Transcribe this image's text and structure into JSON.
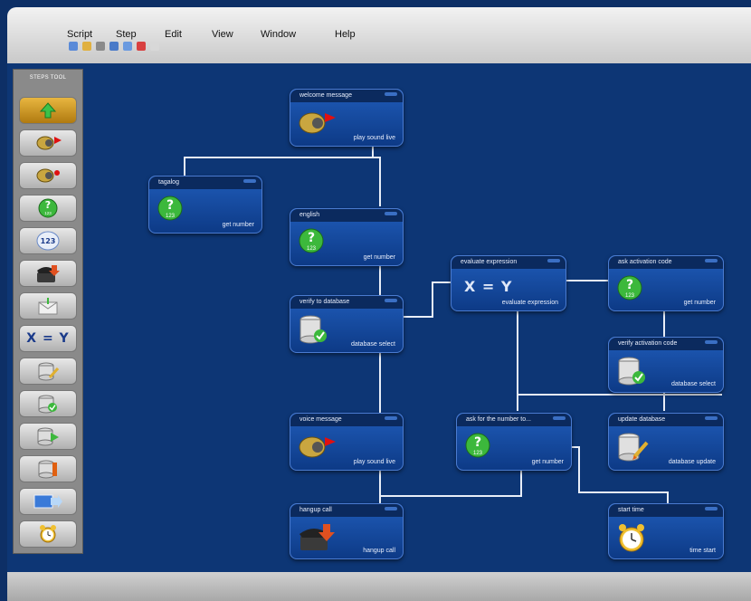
{
  "menu": {
    "items": [
      "Script",
      "Step",
      "Edit",
      "View",
      "Window",
      "Help"
    ]
  },
  "toolbar": {
    "icons": [
      "new-file-icon",
      "open-folder-icon",
      "print-icon",
      "save-icon",
      "save-as-icon",
      "delete-icon",
      "copy-icon"
    ]
  },
  "steps_tool": {
    "title": "STEPS TOOL",
    "items": [
      "up-arrow-icon",
      "play-sound-icon",
      "record-sound-icon",
      "get-number-icon",
      "number-123-icon",
      "hangup-phone-icon",
      "send-mail-icon",
      "expression-icon",
      "edit-database-icon",
      "database-select-icon",
      "database-insert-icon",
      "database-info-icon",
      "transfer-icon",
      "alarm-clock-icon"
    ],
    "expression_label": "X = Y",
    "active_index": 0
  },
  "nodes": {
    "welcome": {
      "title": "welcome message",
      "sub": "play sound live"
    },
    "tagalog": {
      "title": "tagalog",
      "sub": "get number"
    },
    "english": {
      "title": "english",
      "sub": "get number"
    },
    "verify_db": {
      "title": "verify to database",
      "sub": "database select"
    },
    "evaluate": {
      "title": "evaluate expression",
      "sub": "evaluate expression",
      "expr": "X = Y"
    },
    "ask_activation": {
      "title": "ask activation code",
      "sub": "get number"
    },
    "verify_activation": {
      "title": "verify activation code",
      "sub": "database select"
    },
    "voice": {
      "title": "voice message",
      "sub": "play sound live"
    },
    "ask_number": {
      "title": "ask for the number to...",
      "sub": "get number"
    },
    "update_db": {
      "title": "update database",
      "sub": "database update"
    },
    "hangup": {
      "title": "hangup call",
      "sub": "hangup call"
    },
    "start_time": {
      "title": "start time",
      "sub": "time start"
    }
  },
  "icon_text": {
    "number": "123",
    "help": "?"
  }
}
